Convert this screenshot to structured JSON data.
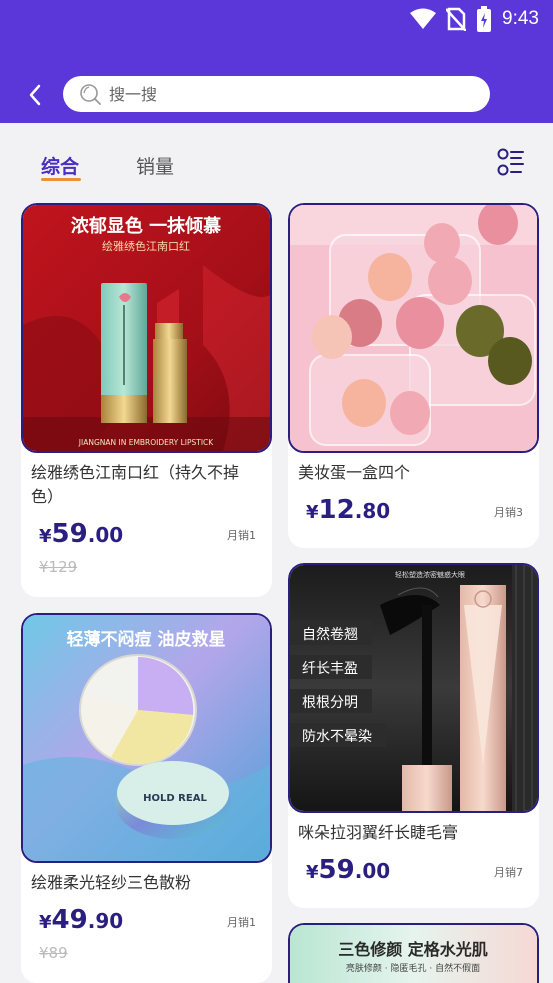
{
  "status": {
    "time": "9:43"
  },
  "search": {
    "placeholder": "搜一搜"
  },
  "tabs": [
    "综合",
    "销量"
  ],
  "products": [
    {
      "title": "绘雅绣色江南口红（持久不掉色）",
      "banner_title": "浓郁显色 一抹倾慕",
      "banner_sub": "绘雅绣色江南口红",
      "banner_caption": "JIANGNAN IN EMBROIDERY LIPSTICK",
      "price_currency": "¥",
      "price_int": "59",
      "price_dec": ".00",
      "original_price": "¥129",
      "sold": "月销1"
    },
    {
      "title": "美妆蛋一盒四个",
      "price_currency": "¥",
      "price_int": "12",
      "price_dec": ".80",
      "sold": "月销3"
    },
    {
      "title": "绘雅柔光轻纱三色散粉",
      "banner_title": "轻薄不闷痘 油皮救星",
      "banner_brand": "HOLD REAL",
      "price_currency": "¥",
      "price_int": "49",
      "price_dec": ".90",
      "original_price": "¥89",
      "sold": "月销1"
    },
    {
      "title": "咪朵拉羽翼纤长睫毛膏",
      "banner_top": "轻松塑造浓密魅惑大眼",
      "banner_tags": [
        "自然卷翘",
        "纤长丰盈",
        "根根分明",
        "防水不晕染"
      ],
      "price_currency": "¥",
      "price_int": "59",
      "price_dec": ".00",
      "sold": "月销7"
    },
    {
      "banner_title": "三色修颜 定格水光肌",
      "banner_sub": "亮肤修颜 · 隐匿毛孔 · 自然不假面"
    }
  ],
  "colors": {
    "header": "#5b36d9",
    "accent": "#2a1f80",
    "underline": "#e9923a"
  }
}
